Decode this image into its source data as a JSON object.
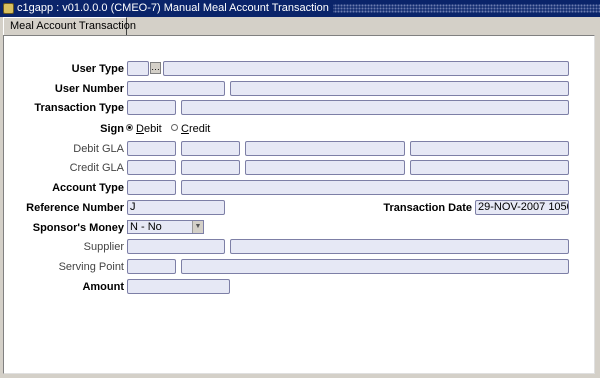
{
  "window": {
    "title": "c1gapp : v01.0.0.0 (CMEO-7) Manual Meal Account Transaction"
  },
  "tabs": [
    {
      "label": "Meal Account Transaction"
    }
  ],
  "form": {
    "user_type": {
      "label": "User Type",
      "lov_glyph": "…"
    },
    "user_number": {
      "label": "User Number"
    },
    "transaction_type": {
      "label": "Transaction Type"
    },
    "sign": {
      "label": "Sign",
      "options": [
        {
          "label": "Debit",
          "selected": true
        },
        {
          "label": "Credit",
          "selected": false
        }
      ]
    },
    "debit_gla": {
      "label": "Debit GLA"
    },
    "credit_gla": {
      "label": "Credit GLA"
    },
    "account_type": {
      "label": "Account Type"
    },
    "reference_number": {
      "label": "Reference Number",
      "value": "J"
    },
    "transaction_date": {
      "label": "Transaction Date",
      "value": "29-NOV-2007 1050"
    },
    "sponsors_money": {
      "label": "Sponsor's Money",
      "value": "N - No"
    },
    "supplier": {
      "label": "Supplier"
    },
    "serving_point": {
      "label": "Serving Point"
    },
    "amount": {
      "label": "Amount"
    }
  }
}
